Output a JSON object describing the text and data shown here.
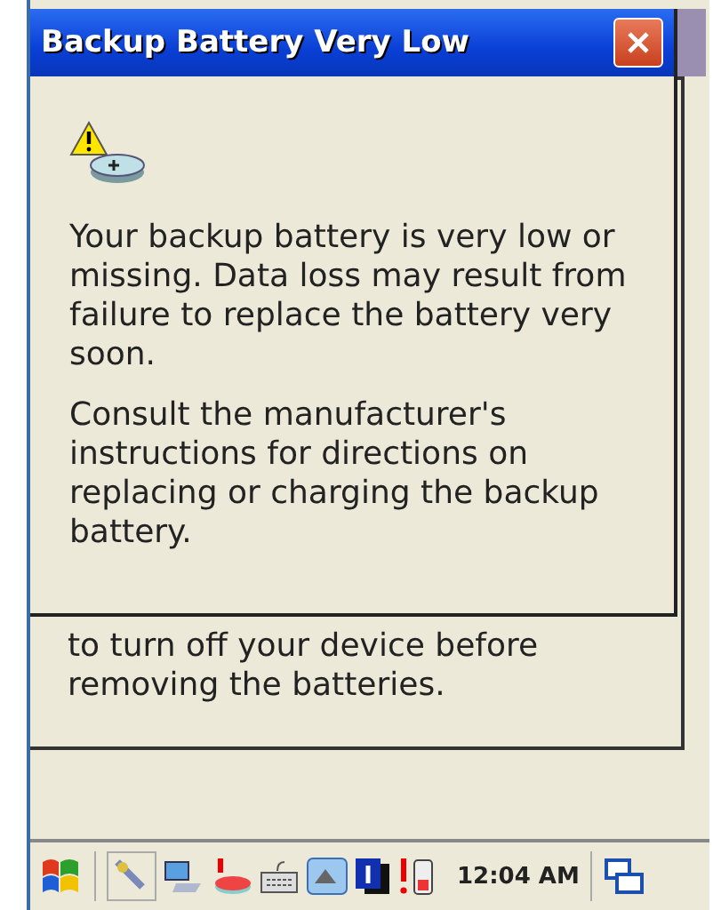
{
  "dialog": {
    "title": "Backup Battery Very Low",
    "paragraphs": [
      "Your backup battery is very low or missing. Data loss may result from failure to replace the battery very soon.",
      "Consult the manufacturer's instructions for directions on replacing or charging the backup battery."
    ]
  },
  "back_window": {
    "text": "to turn off your device before removing the batteries."
  },
  "taskbar": {
    "clock": "12:04 AM"
  }
}
